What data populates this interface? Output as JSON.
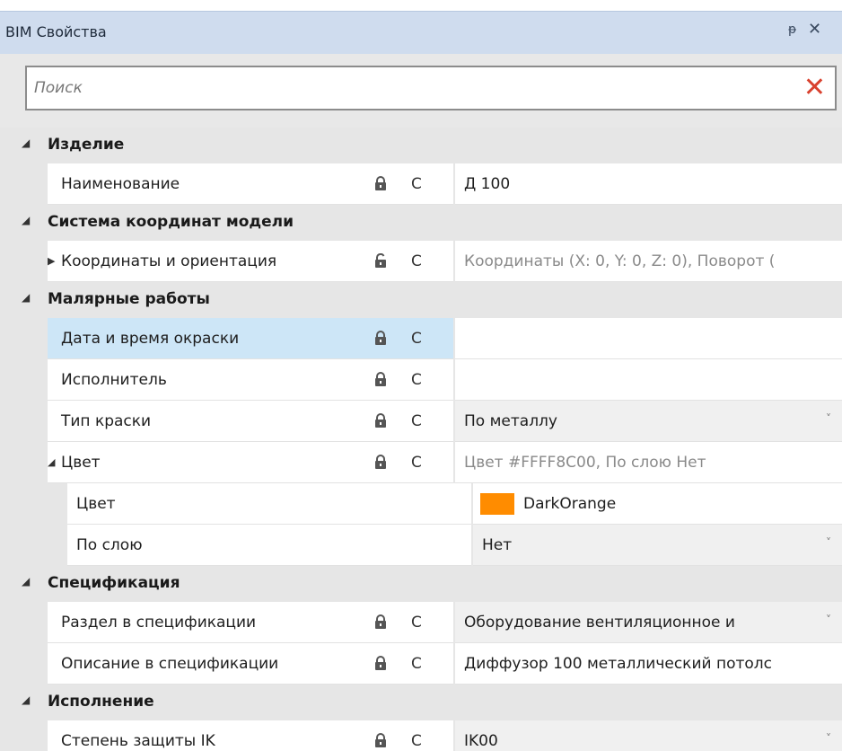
{
  "panel": {
    "title": "BIM Свойства",
    "pin_icon": "pin-icon",
    "close_icon": "close-icon"
  },
  "search": {
    "placeholder": "Поиск",
    "clear_icon": "clear-x-icon",
    "clear_color": "#d9412e"
  },
  "categories": {
    "item": "Изделие",
    "coords": "Система координат модели",
    "paint": "Малярные работы",
    "spec": "Спецификация",
    "exec": "Исполнение"
  },
  "props": {
    "name": {
      "label": "Наименование",
      "flag": "C",
      "value": "Д 100"
    },
    "coords": {
      "label": "Координаты и ориентация",
      "flag": "C",
      "value": "Координаты (X: 0, Y: 0, Z: 0), Поворот ("
    },
    "paint_date": {
      "label": "Дата и время окраски",
      "flag": "C",
      "value": ""
    },
    "executor": {
      "label": "Исполнитель",
      "flag": "C",
      "value": ""
    },
    "paint_type": {
      "label": "Тип краски",
      "flag": "C",
      "value": "По металлу"
    },
    "color": {
      "label": "Цвет",
      "flag": "C",
      "value": "Цвет #FFFF8C00, По слою Нет"
    },
    "color_sub": {
      "label": "Цвет",
      "value": "DarkOrange",
      "swatch": "#ff8c00"
    },
    "by_layer": {
      "label": "По слою",
      "value": "Нет"
    },
    "spec_section": {
      "label": "Раздел в спецификации",
      "flag": "C",
      "value": "Оборудование вентиляционное и"
    },
    "spec_desc": {
      "label": "Описание в спецификации",
      "flag": "C",
      "value": "Диффузор 100 металлический потолс"
    },
    "ik": {
      "label": "Степень защиты IK",
      "flag": "C",
      "value": "IK00"
    }
  },
  "colors": {
    "header_bg": "#cfdcee",
    "category_bg": "#e6e6e6",
    "selected_row": "#cde6f7"
  }
}
